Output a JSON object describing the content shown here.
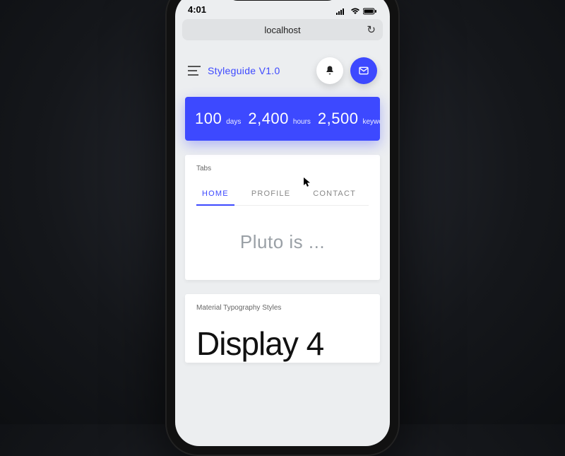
{
  "status": {
    "time": "4:01"
  },
  "browser": {
    "url": "localhost"
  },
  "header": {
    "title": "Styleguide V1.0"
  },
  "stats": {
    "v1": "100",
    "l1": "days",
    "v2": "2,400",
    "l2": "hours",
    "v3": "2,500",
    "l3": "keywords"
  },
  "tabs_card": {
    "label": "Tabs",
    "tabs": {
      "home": "HOME",
      "profile": "PROFILE",
      "contact": "CONTACT"
    },
    "body": "Pluto is ..."
  },
  "typo_card": {
    "label": "Material Typography Styles",
    "display": "Display 4"
  },
  "colors": {
    "accent": "#3d49ff"
  }
}
